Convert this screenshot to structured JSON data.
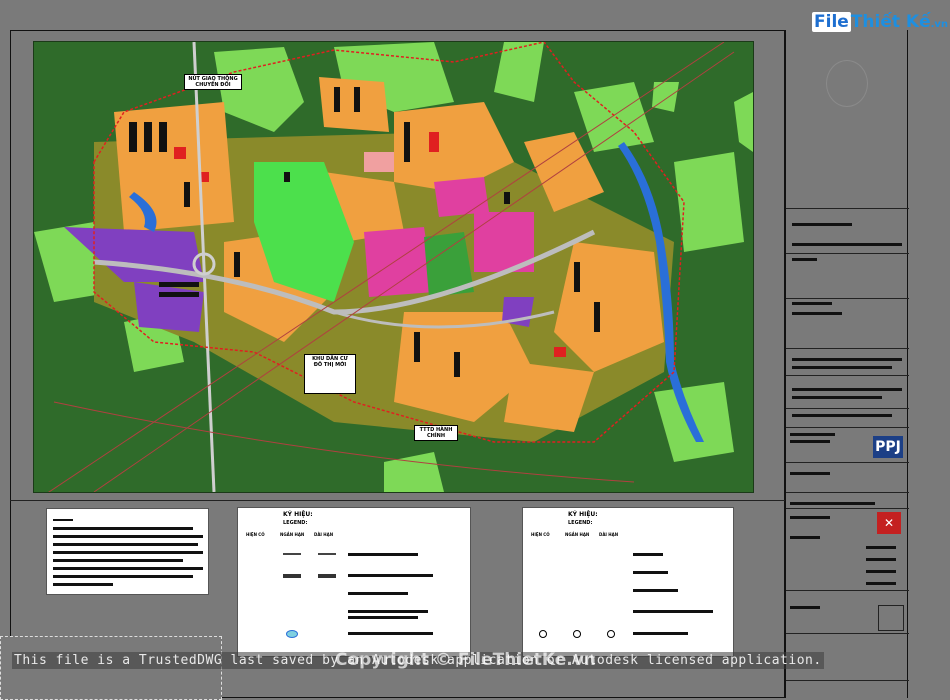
{
  "watermark": {
    "trusted_text": "This file is a TrustedDWG last saved by an Autodesk application or Autodesk licensed application.",
    "copyright": "Copyright © FileThietKe.vn"
  },
  "logo": {
    "part1": "File",
    "part2": "Thiết Kế",
    "part3": ".vn"
  },
  "titleblock": {
    "brand": "PPJ"
  },
  "map_labels": {
    "top_left": "NÚT GIAO THÔNG\nCHUYỂN ĐỔI",
    "center": "KHU DÂN CƯ\nĐÔ THỊ MỚI",
    "bottom": "TTTD HÀNH\nCHÍNH"
  },
  "legend1": {
    "title": "KÝ HIỆU:",
    "subtitle": "LEGEND:",
    "col_existing": "HIỆN CÓ",
    "col_planned": "NGẮN HẠN",
    "col_long": "DÀI HẠN"
  },
  "legend2": {
    "title": "KÝ HIỆU:",
    "subtitle": "LEGEND:",
    "col_existing": "HIỆN CÓ",
    "col_planned": "NGẮN HẠN",
    "col_long": "DÀI HẠN"
  },
  "colors": {
    "background": "#7a7a7a",
    "forest": "#2f6b2a",
    "residential": "#f0a040",
    "commercial": "#e040a0",
    "park": "#7ed957",
    "industrial": "#8040c0",
    "water": "#2a6fd8",
    "boundary": "#e02020"
  }
}
